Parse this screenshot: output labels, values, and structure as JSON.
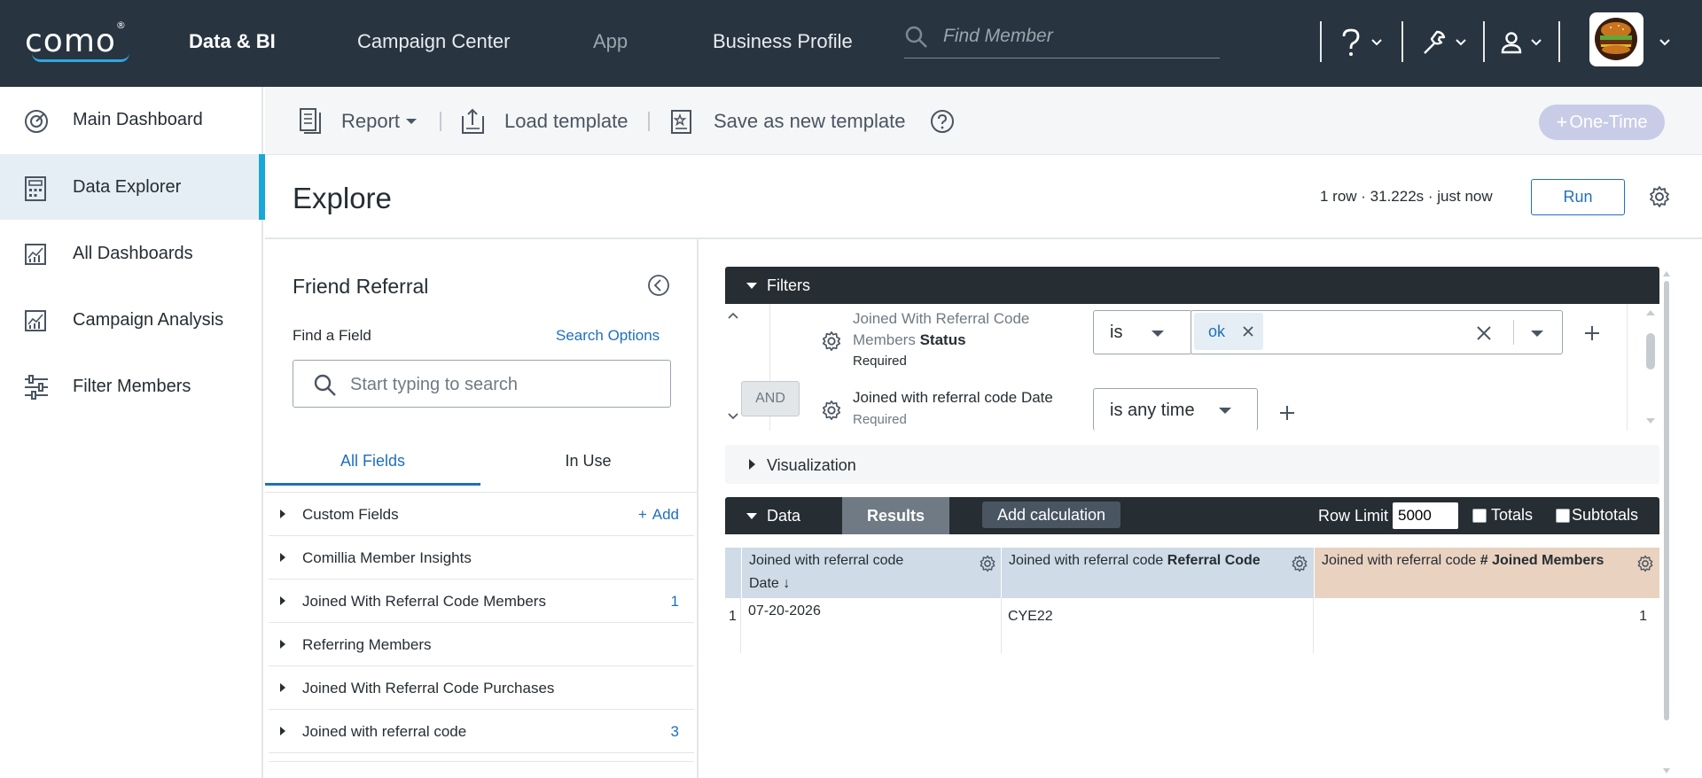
{
  "topbar": {
    "logo": "como",
    "logo_mark": "®",
    "nav": [
      "Data & BI",
      "Campaign Center",
      "App",
      "Business Profile"
    ],
    "search_placeholder": "Find Member"
  },
  "sidebar": {
    "items": [
      {
        "label": "Main Dashboard",
        "icon": "speedometer-icon"
      },
      {
        "label": "Data Explorer",
        "icon": "calculator-icon"
      },
      {
        "label": "All Dashboards",
        "icon": "chart-icon"
      },
      {
        "label": "Campaign Analysis",
        "icon": "chart-icon"
      },
      {
        "label": "Filter Members",
        "icon": "sliders-icon"
      }
    ]
  },
  "toolbar": {
    "report": "Report",
    "load_template": "Load template",
    "save_template": "Save as new template",
    "one_time": "One-Time"
  },
  "explore": {
    "title": "Explore",
    "status": "1 row · 31.222s · just now",
    "run": "Run"
  },
  "field_picker": {
    "title": "Friend Referral",
    "find_label": "Find a Field",
    "search_options": "Search Options",
    "search_placeholder": "Start typing to search",
    "tabs": [
      "All Fields",
      "In Use"
    ],
    "groups": [
      {
        "label": "Custom Fields",
        "action": "Add"
      },
      {
        "label": "Comillia Member Insights",
        "count": ""
      },
      {
        "label": "Joined With Referral Code Members",
        "count": "1"
      },
      {
        "label": "Referring Members",
        "count": ""
      },
      {
        "label": "Joined With Referral Code Purchases",
        "count": ""
      },
      {
        "label": "Joined with referral code",
        "count": "3"
      }
    ]
  },
  "filters": {
    "header": "Filters",
    "rows": [
      {
        "label_prefix": "Joined With Referral Code Members",
        "label_field": "Status",
        "required": "Required",
        "operator": "is",
        "value_chip": "ok"
      },
      {
        "label_prefix": "Joined with referral code",
        "label_field": "Date",
        "required": "Required",
        "operator": "is any time"
      }
    ],
    "and": "AND"
  },
  "visualization": {
    "header": "Visualization"
  },
  "data_panel": {
    "header": "Data",
    "results": "Results",
    "add_calculation": "Add calculation",
    "row_limit_label": "Row Limit",
    "row_limit": "5000",
    "totals": "Totals",
    "subtotals": "Subtotals",
    "columns": [
      {
        "prefix": "Joined with referral code",
        "field": "Date",
        "sort": "↓"
      },
      {
        "prefix": "Joined with referral code",
        "field": "Referral Code"
      },
      {
        "prefix": "Joined with referral code",
        "field": "# Joined Members"
      }
    ],
    "rows": [
      {
        "num": "1",
        "cells": [
          "07-20-2026",
          "CYE22",
          "1"
        ]
      }
    ]
  },
  "colors": {
    "topbar": "#283440",
    "accent": "#19a6d8",
    "link": "#1f6fbf",
    "measure_header": "#e9d2c0",
    "dim_header": "#cfdbe6"
  }
}
